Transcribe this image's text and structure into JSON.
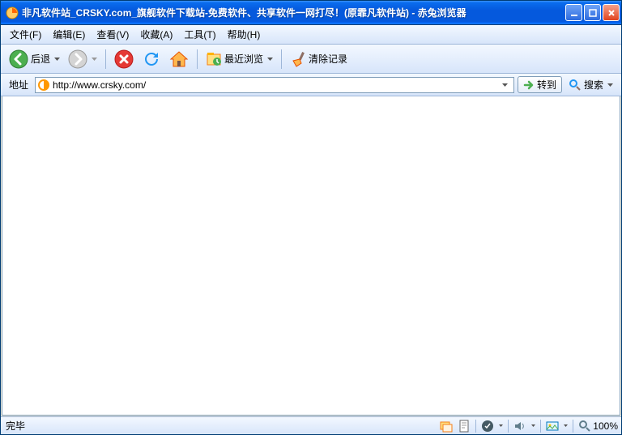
{
  "window": {
    "title": "非凡软件站_CRSKY.com_旗舰软件下载站-免费软件、共享软件一网打尽！(原霏凡软件站)  -  赤兔浏览器"
  },
  "menu": {
    "file": "文件(F)",
    "edit": "编辑(E)",
    "view": "查看(V)",
    "favorites": "收藏(A)",
    "tools": "工具(T)",
    "help": "帮助(H)"
  },
  "toolbar": {
    "back_label": "后退",
    "recent_label": "最近浏览",
    "clear_label": "清除记录"
  },
  "address": {
    "label": "地址",
    "url": "http://www.crsky.com/",
    "go_label": "转到",
    "search_label": "搜索"
  },
  "status": {
    "text": "完毕",
    "zoom": "100%"
  }
}
